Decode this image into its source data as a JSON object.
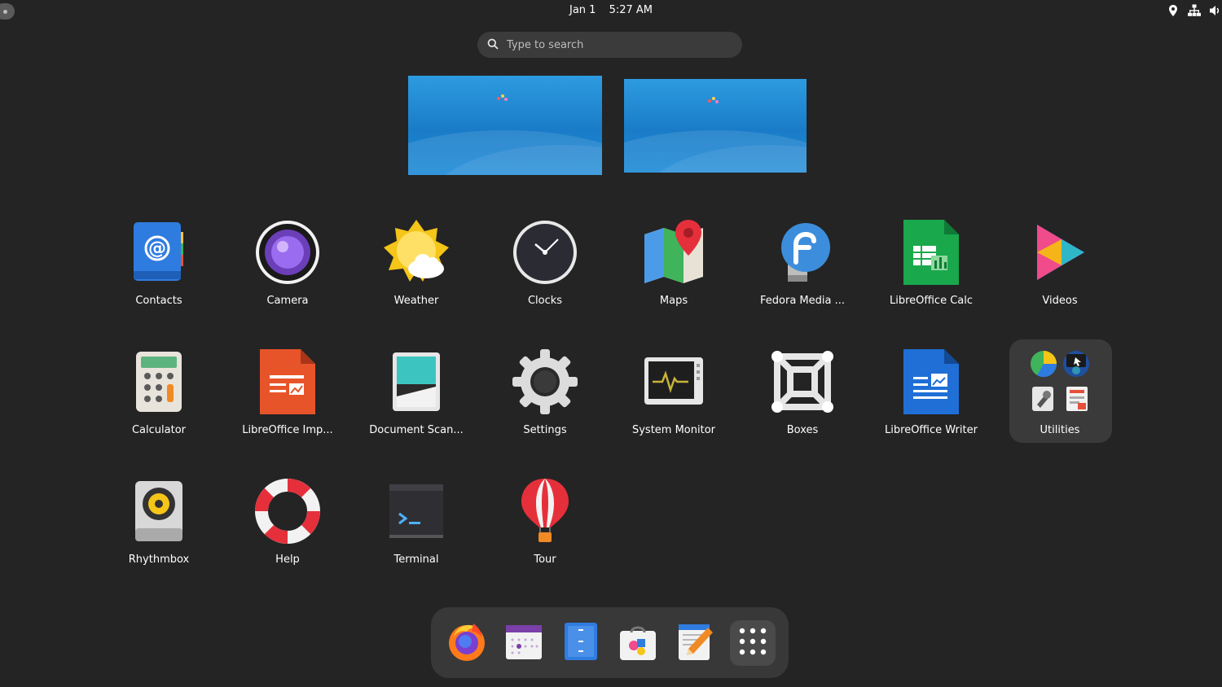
{
  "top_bar": {
    "date": "Jan 1",
    "time": "5:27 AM",
    "tray_icons": [
      "location-icon",
      "network-icon",
      "volume-icon"
    ]
  },
  "search": {
    "placeholder": "Type to search"
  },
  "workspaces": [
    "workspace-1",
    "workspace-2"
  ],
  "apps": [
    {
      "label": "Contacts",
      "icon": "contacts-icon"
    },
    {
      "label": "Camera",
      "icon": "camera-icon"
    },
    {
      "label": "Weather",
      "icon": "weather-icon"
    },
    {
      "label": "Clocks",
      "icon": "clocks-icon"
    },
    {
      "label": "Maps",
      "icon": "maps-icon"
    },
    {
      "label": "Fedora Media ...",
      "icon": "fedora-media-writer-icon"
    },
    {
      "label": "LibreOffice Calc",
      "icon": "libreoffice-calc-icon"
    },
    {
      "label": "Videos",
      "icon": "videos-icon"
    },
    {
      "label": "Calculator",
      "icon": "calculator-icon"
    },
    {
      "label": "LibreOffice Imp...",
      "icon": "libreoffice-impress-icon"
    },
    {
      "label": "Document Scan...",
      "icon": "document-scanner-icon"
    },
    {
      "label": "Settings",
      "icon": "settings-icon"
    },
    {
      "label": "System Monitor",
      "icon": "system-monitor-icon"
    },
    {
      "label": "Boxes",
      "icon": "boxes-icon"
    },
    {
      "label": "LibreOffice Writer",
      "icon": "libreoffice-writer-icon"
    },
    {
      "label": "Utilities",
      "icon": "utilities-folder-icon"
    },
    {
      "label": "Rhythmbox",
      "icon": "rhythmbox-icon"
    },
    {
      "label": "Help",
      "icon": "help-icon"
    },
    {
      "label": "Terminal",
      "icon": "terminal-icon"
    },
    {
      "label": "Tour",
      "icon": "tour-icon"
    }
  ],
  "dock": [
    "firefox-icon",
    "calendar-icon",
    "files-icon",
    "software-icon",
    "text-editor-icon",
    "show-apps-icon"
  ],
  "colors": {
    "background": "#242424",
    "dock": "#383838",
    "search": "#3b3b3b",
    "folder": "#3a3a3a"
  }
}
